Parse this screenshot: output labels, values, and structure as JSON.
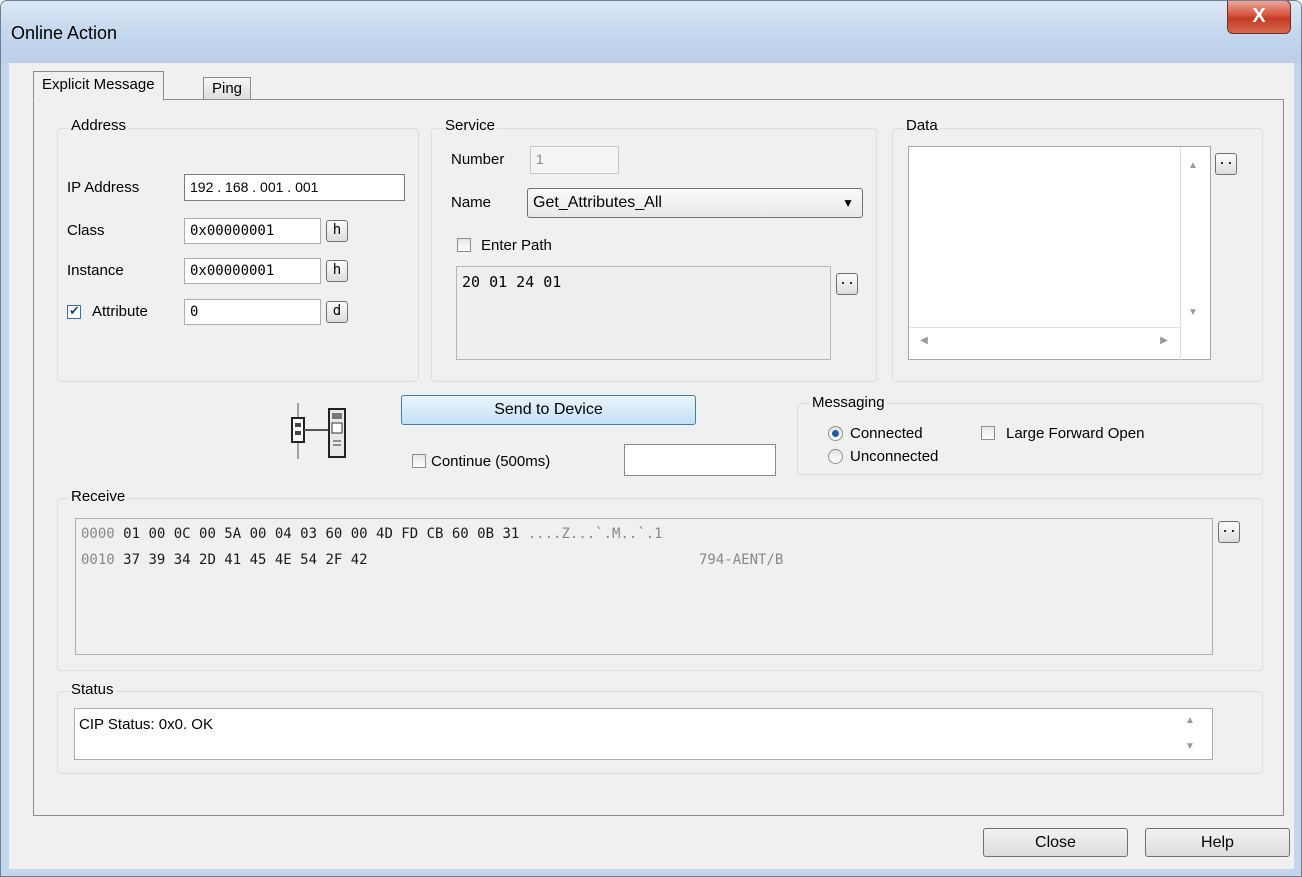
{
  "window": {
    "title": "Online Action",
    "close_glyph": "X"
  },
  "tabs": [
    {
      "label": "Explicit Message"
    },
    {
      "label": "Ping"
    }
  ],
  "address": {
    "group_label": "Address",
    "ip_label": "IP Address",
    "ip_value": "192 . 168 . 001 . 001",
    "class_label": "Class",
    "class_value": "0x00000001",
    "class_fmt": "h",
    "instance_label": "Instance",
    "instance_value": "0x00000001",
    "instance_fmt": "h",
    "attribute_label": "Attribute",
    "attribute_checked": true,
    "attribute_value": "0",
    "attribute_fmt": "d"
  },
  "service": {
    "group_label": "Service",
    "number_label": "Number",
    "number_value": "1",
    "name_label": "Name",
    "name_value": "Get_Attributes_All",
    "enter_path_label": "Enter Path",
    "enter_path_checked": false,
    "path_value": "20 01 24 01",
    "path_browse": ".."
  },
  "data": {
    "group_label": "Data",
    "browse": ".."
  },
  "send": {
    "button_label": "Send to Device",
    "continue_label": "Continue (500ms)",
    "continue_checked": false,
    "continue_value": ""
  },
  "messaging": {
    "group_label": "Messaging",
    "connected_label": "Connected",
    "connected_selected": true,
    "unconnected_label": "Unconnected",
    "large_forward_open_label": "Large Forward Open",
    "large_forward_open_checked": false
  },
  "receive": {
    "group_label": "Receive",
    "browse": "..",
    "rows": [
      {
        "offset": "0000",
        "hex": "01 00 0C 00 5A 00 04 03 60 00 4D FD CB 60 0B 31",
        "ascii": "....Z...`.M..`.1"
      },
      {
        "offset": "0010",
        "hex": "37 39 34 2D 41 45 4E 54 2F 42",
        "ascii": "794-AENT/B"
      }
    ]
  },
  "status": {
    "group_label": "Status",
    "text": "CIP Status: 0x0. OK"
  },
  "buttons": {
    "close": "Close",
    "help": "Help"
  },
  "colors": {
    "send_button": "#c2e1f5",
    "title_bar": "#c7d9ee",
    "close_button": "#c23a23"
  }
}
